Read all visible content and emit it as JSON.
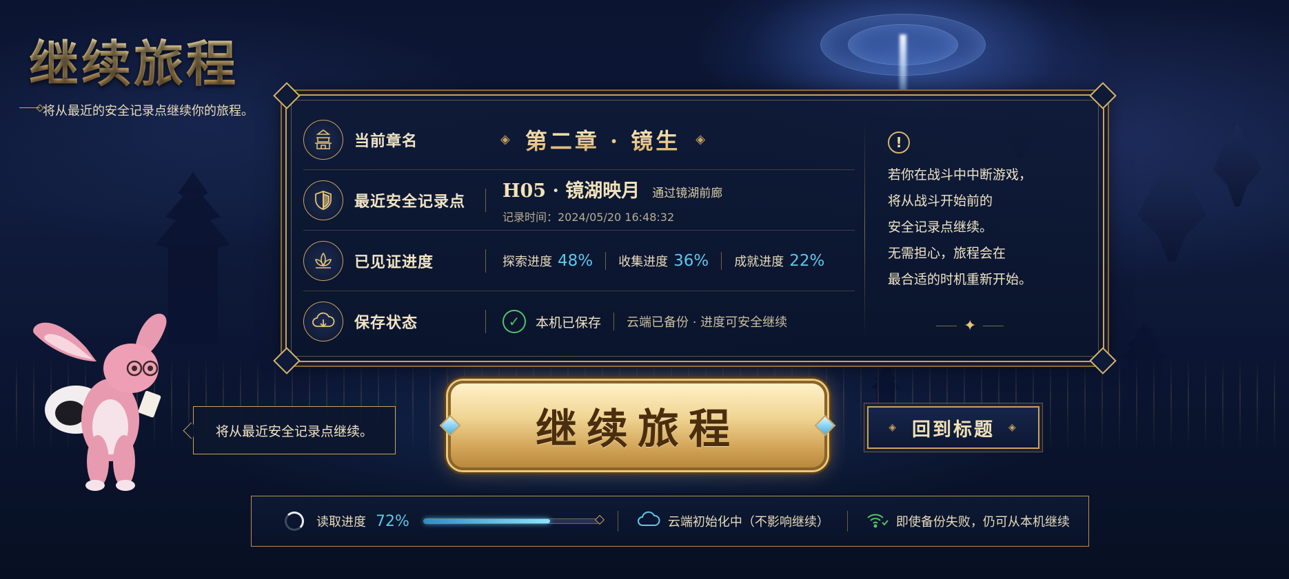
{
  "title": "继续旅程",
  "subtitle": "将从最近的安全记录点继续你的旅程。",
  "panel": {
    "rows": [
      {
        "icon": "pagoda-icon",
        "label": "当前章名"
      },
      {
        "icon": "shield-icon",
        "label": "最近安全记录点"
      },
      {
        "icon": "lotus-icon",
        "label": "已见证进度"
      },
      {
        "icon": "cloud-download-icon",
        "label": "保存状态"
      }
    ],
    "chapter": "第二章 · 镜生",
    "save_point": {
      "name": "H05 · 镜湖映月",
      "via": "通过镜湖前廊",
      "time": "记录时间：2024/05/20 16:48:32"
    },
    "progress": [
      {
        "label": "探索进度",
        "value": "48%"
      },
      {
        "label": "收集进度",
        "value": "36%"
      },
      {
        "label": "成就进度",
        "value": "22%"
      }
    ],
    "save_status": {
      "local": "本机已保存",
      "cloud": "云端已备份 · 进度可安全继续"
    },
    "notice": {
      "icon": "exclamation-icon",
      "lines": [
        "若你在战斗中中断游戏，",
        "将从战斗开始前的",
        "安全记录点继续。",
        "无需担心，旅程会在",
        "最合适的时机重新开始。"
      ]
    }
  },
  "bubble": "将从最近安全记录点继续。",
  "buttons": {
    "continue": "继续旅程",
    "back": "回到标题"
  },
  "status_bar": {
    "loading_label": "读取进度",
    "loading_pct": "72%",
    "loading_value": 0.72,
    "cloud_status": "云端初始化中（不影响继续）",
    "backup_note": "即使备份失败，仍可从本机继续"
  },
  "colors": {
    "gold": "#c9a460",
    "accent_blue": "#5cc8ea",
    "ok_green": "#53c46a",
    "panel_bg": "#0e1a36"
  }
}
